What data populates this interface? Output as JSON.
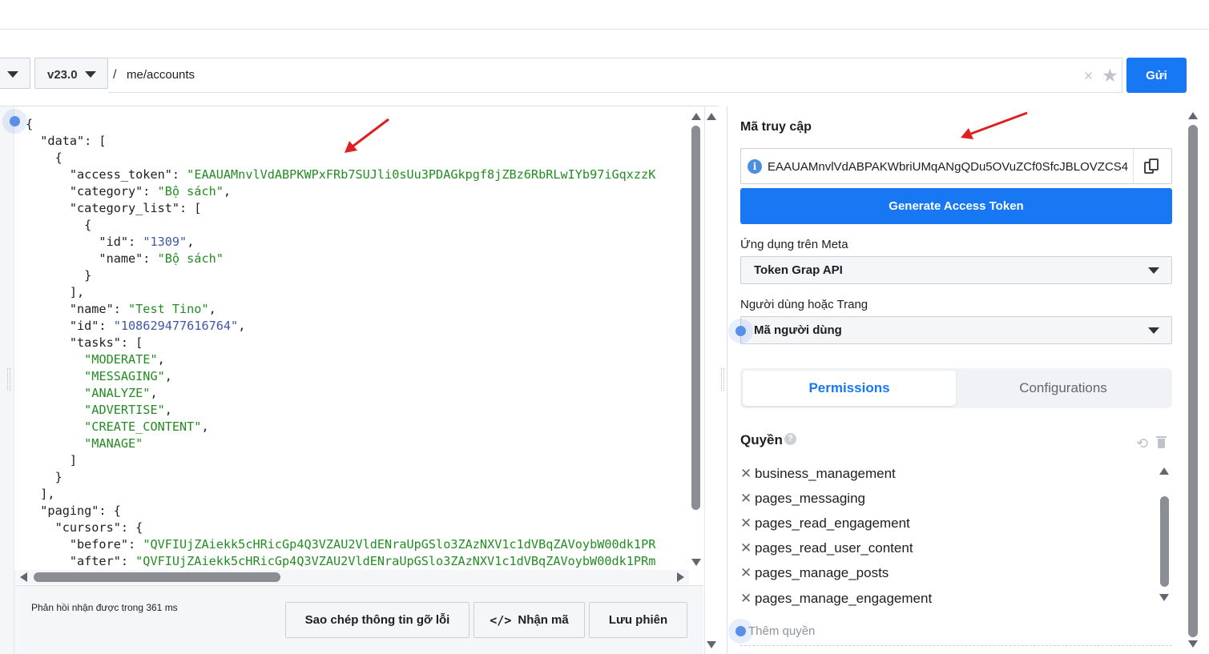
{
  "request": {
    "version": "v23.0",
    "slash": "/",
    "path": "me/accounts",
    "clear_glyph": "×",
    "star_glyph": "★",
    "send_label": "Gửi"
  },
  "response": {
    "lines": [
      [
        {
          "t": "{",
          "c": "p"
        }
      ],
      [
        {
          "t": "  \"data\": [",
          "c": "p"
        }
      ],
      [
        {
          "t": "    {",
          "c": "p"
        }
      ],
      [
        {
          "t": "      \"access_token\": ",
          "c": "p"
        },
        {
          "t": "\"EAAUAMnvlVdABPKWPxFRb7SUJli0sUu3PDAGkpgf8jZBz6RbRLwIYb97iGqxzzK",
          "c": "s"
        }
      ],
      [
        {
          "t": "      \"category\": ",
          "c": "p"
        },
        {
          "t": "\"Bộ sách\"",
          "c": "s"
        },
        {
          "t": ",",
          "c": "p"
        }
      ],
      [
        {
          "t": "      \"category_list\": [",
          "c": "p"
        }
      ],
      [
        {
          "t": "        {",
          "c": "p"
        }
      ],
      [
        {
          "t": "          \"id\": ",
          "c": "p"
        },
        {
          "t": "\"1309\"",
          "c": "n"
        },
        {
          "t": ",",
          "c": "p"
        }
      ],
      [
        {
          "t": "          \"name\": ",
          "c": "p"
        },
        {
          "t": "\"Bộ sách\"",
          "c": "s"
        }
      ],
      [
        {
          "t": "        }",
          "c": "p"
        }
      ],
      [
        {
          "t": "      ],",
          "c": "p"
        }
      ],
      [
        {
          "t": "      \"name\": ",
          "c": "p"
        },
        {
          "t": "\"Test Tino\"",
          "c": "s"
        },
        {
          "t": ",",
          "c": "p"
        }
      ],
      [
        {
          "t": "      \"id\": ",
          "c": "p"
        },
        {
          "t": "\"108629477616764\"",
          "c": "n"
        },
        {
          "t": ",",
          "c": "p"
        }
      ],
      [
        {
          "t": "      \"tasks\": [",
          "c": "p"
        }
      ],
      [
        {
          "t": "        ",
          "c": "p"
        },
        {
          "t": "\"MODERATE\"",
          "c": "s"
        },
        {
          "t": ",",
          "c": "p"
        }
      ],
      [
        {
          "t": "        ",
          "c": "p"
        },
        {
          "t": "\"MESSAGING\"",
          "c": "s"
        },
        {
          "t": ",",
          "c": "p"
        }
      ],
      [
        {
          "t": "        ",
          "c": "p"
        },
        {
          "t": "\"ANALYZE\"",
          "c": "s"
        },
        {
          "t": ",",
          "c": "p"
        }
      ],
      [
        {
          "t": "        ",
          "c": "p"
        },
        {
          "t": "\"ADVERTISE\"",
          "c": "s"
        },
        {
          "t": ",",
          "c": "p"
        }
      ],
      [
        {
          "t": "        ",
          "c": "p"
        },
        {
          "t": "\"CREATE_CONTENT\"",
          "c": "s"
        },
        {
          "t": ",",
          "c": "p"
        }
      ],
      [
        {
          "t": "        ",
          "c": "p"
        },
        {
          "t": "\"MANAGE\"",
          "c": "s"
        }
      ],
      [
        {
          "t": "      ]",
          "c": "p"
        }
      ],
      [
        {
          "t": "    }",
          "c": "p"
        }
      ],
      [
        {
          "t": "  ],",
          "c": "p"
        }
      ],
      [
        {
          "t": "  \"paging\": {",
          "c": "p"
        }
      ],
      [
        {
          "t": "    \"cursors\": {",
          "c": "p"
        }
      ],
      [
        {
          "t": "      \"before\": ",
          "c": "p"
        },
        {
          "t": "\"QVFIUjZAiekk5cHRicGp4Q3VZAU2VldENraUpGSlo3ZAzNXV1c1dVBqZAVoybW00dk1PR",
          "c": "s"
        }
      ],
      [
        {
          "t": "      \"after\": ",
          "c": "p"
        },
        {
          "t": "\"QVFIUjZAiekk5cHRicGp4Q3VZAU2VldENraUpGSlo3ZAzNXV1c1dVBqZAVoybW00dk1PRm",
          "c": "s"
        }
      ]
    ],
    "response_time": "Phản hồi nhận được trong 361 ms",
    "copy_debug_label": "Sao chép thông tin gỡ lỗi",
    "get_code_label": "Nhận mã",
    "get_code_icon_glyph": "</>",
    "save_session_label": "Lưu phiên"
  },
  "sidebar": {
    "access_token_title": "Mã truy cập",
    "access_token_value": "EAAUAMnvlVdABPAKWbriUMqANgQDu5OVuZCf0SfcJBLOVZCS4",
    "info_glyph": "i",
    "generate_label": "Generate Access Token",
    "app_label": "Ứng dụng trên Meta",
    "app_value": "Token Grap API",
    "user_label": "Người dùng hoặc Trang",
    "user_value": "Mã người dùng",
    "tabs": {
      "permissions": "Permissions",
      "configurations": "Configurations"
    },
    "permissions_title": "Quyền",
    "help_glyph": "?",
    "undo_glyph": "⟲",
    "remove_glyph": "✕",
    "permissions": [
      "business_management",
      "pages_messaging",
      "pages_read_engagement",
      "pages_read_user_content",
      "pages_manage_posts",
      "pages_manage_engagement"
    ],
    "add_permission_placeholder": "Thêm quyền"
  },
  "colors": {
    "primary": "#1877f2",
    "json_string": "#238c23",
    "json_number": "#3e58a3",
    "annotation_arrow": "#e02020"
  }
}
